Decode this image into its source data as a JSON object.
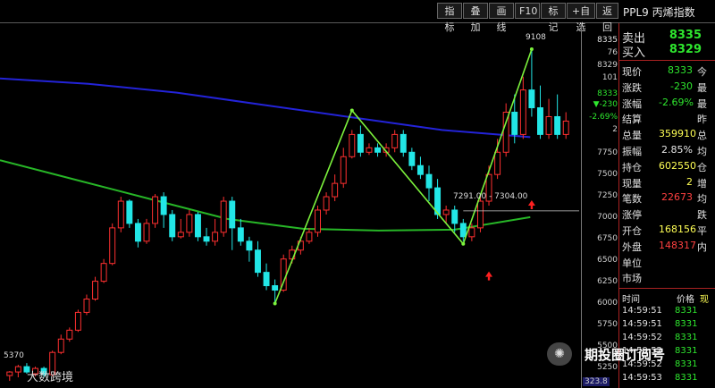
{
  "toolbar": {
    "buttons": [
      "指标",
      "叠加",
      "画线",
      "F10",
      "标记",
      "+自选",
      "返回"
    ],
    "contract": "PPL9 丙烯指数"
  },
  "chart_data": {
    "type": "candlestick",
    "ylim": [
      5300,
      9400
    ],
    "candles": [
      [
        5440,
        5480,
        5380,
        5490
      ],
      [
        5480,
        5540,
        5420,
        5560
      ],
      [
        5540,
        5480,
        5460,
        5580
      ],
      [
        5460,
        5520,
        5430,
        5540
      ],
      [
        5520,
        5450,
        5420,
        5540
      ],
      [
        5450,
        5700,
        5430,
        5720
      ],
      [
        5700,
        5850,
        5680,
        5900
      ],
      [
        5850,
        5950,
        5820,
        5980
      ],
      [
        5950,
        6150,
        5930,
        6180
      ],
      [
        6150,
        6300,
        6120,
        6350
      ],
      [
        6300,
        6500,
        6280,
        6550
      ],
      [
        6500,
        6700,
        6480,
        6750
      ],
      [
        6700,
        7100,
        6680,
        7150
      ],
      [
        7100,
        7400,
        7050,
        7450
      ],
      [
        7400,
        7150,
        7100,
        7420
      ],
      [
        7150,
        6950,
        6880,
        7200
      ],
      [
        6950,
        7150,
        6920,
        7200
      ],
      [
        7150,
        7450,
        7100,
        7480
      ],
      [
        7450,
        7250,
        7100,
        7500
      ],
      [
        7250,
        7000,
        6950,
        7300
      ],
      [
        7000,
        7050,
        6980,
        7200
      ],
      [
        7050,
        7250,
        7000,
        7300
      ],
      [
        7250,
        7000,
        6950,
        7280
      ],
      [
        7000,
        6950,
        6900,
        7100
      ],
      [
        6950,
        7050,
        6900,
        7200
      ],
      [
        7050,
        7400,
        7000,
        7450
      ],
      [
        7400,
        7100,
        6850,
        7450
      ],
      [
        7100,
        6950,
        6900,
        7200
      ],
      [
        6950,
        6850,
        6720,
        7000
      ],
      [
        6850,
        6600,
        6550,
        6950
      ],
      [
        6600,
        6450,
        6400,
        6700
      ],
      [
        6450,
        6400,
        6250,
        6520
      ],
      [
        6400,
        6750,
        6380,
        6800
      ],
      [
        6750,
        6850,
        6700,
        6900
      ],
      [
        6850,
        6950,
        6800,
        7000
      ],
      [
        6950,
        7050,
        6920,
        7100
      ],
      [
        7050,
        7300,
        7000,
        7350
      ],
      [
        7300,
        7450,
        7250,
        7500
      ],
      [
        7450,
        7600,
        7400,
        7700
      ],
      [
        7600,
        7900,
        7550,
        8000
      ],
      [
        7900,
        8150,
        7880,
        8200
      ],
      [
        8150,
        7950,
        7900,
        8250
      ],
      [
        7950,
        8000,
        7920,
        8050
      ],
      [
        8000,
        7950,
        7900,
        8050
      ],
      [
        7950,
        8000,
        7900,
        8050
      ],
      [
        8000,
        8150,
        7950,
        8200
      ],
      [
        8150,
        7950,
        7900,
        8200
      ],
      [
        7950,
        7800,
        7750,
        8000
      ],
      [
        7800,
        7700,
        7650,
        7900
      ],
      [
        7700,
        7550,
        7400,
        7800
      ],
      [
        7550,
        7250,
        7200,
        7650
      ],
      [
        7250,
        7300,
        7150,
        7350
      ],
      [
        7300,
        7150,
        7050,
        7350
      ],
      [
        7150,
        7000,
        6950,
        7200
      ],
      [
        7000,
        7100,
        6950,
        7150
      ],
      [
        7100,
        7400,
        7050,
        7450
      ],
      [
        7400,
        7700,
        7350,
        7800
      ],
      [
        7700,
        7950,
        7650,
        8100
      ],
      [
        7950,
        8400,
        7900,
        8500
      ],
      [
        8400,
        8150,
        8050,
        8600
      ],
      [
        8150,
        8650,
        8100,
        8800
      ],
      [
        8650,
        8450,
        8350,
        9108
      ],
      [
        8450,
        8150,
        8100,
        8700
      ],
      [
        8150,
        8350,
        8100,
        8550
      ],
      [
        8350,
        8150,
        8100,
        8600
      ],
      [
        8150,
        8300,
        8100,
        8400
      ]
    ],
    "ma_long_blue": [
      8780,
      8720,
      8620,
      8480,
      8340,
      8200,
      8120
    ],
    "ma_mid_green": [
      7860,
      7640,
      7420,
      7200,
      7090,
      7070,
      7080,
      7220
    ],
    "zigzag": [
      [
        6300,
        8400
      ],
      [
        6300,
        8400,
        7000,
        9108
      ]
    ],
    "annotations": {
      "high_mark": "9108",
      "range_mark": "7291.00 - 7304.00",
      "low_mark": "5370"
    }
  },
  "axis": {
    "top_values": [
      "8335",
      "76",
      "8329",
      "101",
      "8333"
    ],
    "change": "▼-230",
    "change_pct": "-2.69%",
    "zero": "2",
    "ticks": [
      "7750",
      "7500",
      "7250",
      "7000",
      "6750",
      "6500",
      "6250",
      "6000",
      "5750",
      "5500",
      "5250"
    ]
  },
  "quote": {
    "sell_label": "卖出",
    "sell_value": "8335",
    "buy_label": "买入",
    "buy_value": "8329",
    "rows": [
      {
        "label": "现价",
        "value": "8333",
        "ext": "今",
        "color": "green"
      },
      {
        "label": "涨跌",
        "value": "-230",
        "ext": "最",
        "color": "green"
      },
      {
        "label": "涨幅",
        "value": "-2.69%",
        "ext": "最",
        "color": "green"
      },
      {
        "label": "结算",
        "value": "",
        "ext": "昨",
        "color": "white"
      },
      {
        "label": "总量",
        "value": "359910",
        "ext": "总",
        "color": "yellow"
      },
      {
        "label": "振幅",
        "value": "2.85%",
        "ext": "均",
        "color": "white"
      },
      {
        "label": "持仓",
        "value": "602550",
        "ext": "仓",
        "color": "yellow"
      },
      {
        "label": "现量",
        "value": "2",
        "ext": "增",
        "color": "yellow"
      },
      {
        "label": "笔数",
        "value": "22673",
        "ext": "均",
        "color": "red"
      },
      {
        "label": "涨停",
        "value": "",
        "ext": "跌",
        "color": "white"
      },
      {
        "label": "开仓",
        "value": "168156",
        "ext": "平",
        "color": "yellow"
      },
      {
        "label": "外盘",
        "value": "148317",
        "ext": "内",
        "color": "red"
      },
      {
        "label": "单位",
        "value": "",
        "ext": "",
        "color": "white"
      },
      {
        "label": "市场",
        "value": "",
        "ext": "",
        "color": "white"
      }
    ],
    "ticks_header": {
      "time": "时间",
      "price": "价格",
      "vol": "现"
    },
    "ticks": [
      {
        "time": "14:59:51",
        "price": "8331"
      },
      {
        "time": "14:59:51",
        "price": "8331"
      },
      {
        "time": "14:59:52",
        "price": "8331"
      },
      {
        "time": "14:59:52",
        "price": "8331"
      },
      {
        "time": "14:59:52",
        "price": "8331"
      },
      {
        "time": "14:59:53",
        "price": "8331"
      }
    ]
  },
  "watermark": {
    "title": "期投圈订阅号",
    "logo": "✺",
    "sub": "大数跨境"
  },
  "bottom_tag": "323.8"
}
